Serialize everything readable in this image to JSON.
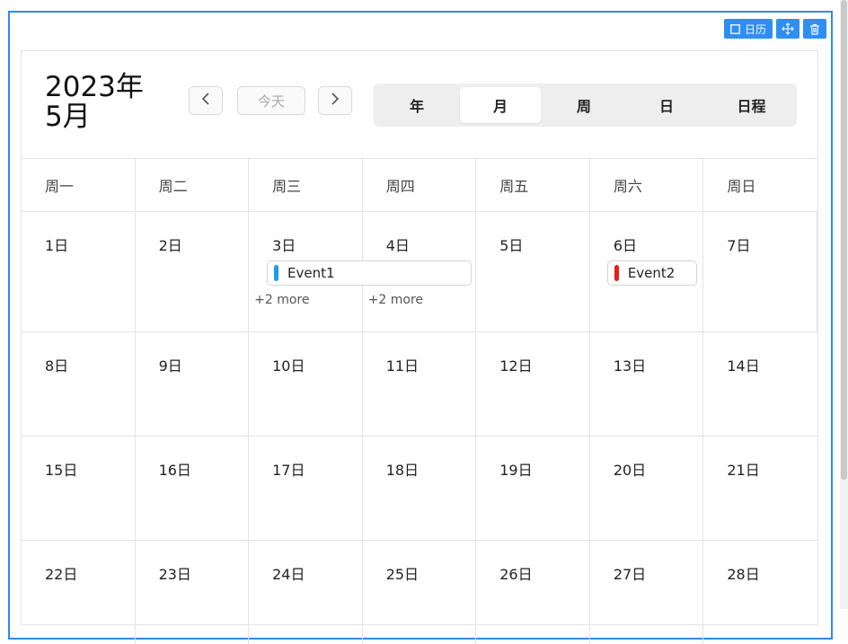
{
  "toolbar": {
    "calendar_label": "日历",
    "calendar_icon": "calendar-square-icon",
    "move_icon": "move-arrows-icon",
    "delete_icon": "trash-icon"
  },
  "header": {
    "title_line1": "2023年",
    "title_line2": "5月",
    "prev": "‹",
    "today": "今天",
    "next": "›"
  },
  "views": [
    {
      "label": "年",
      "active": false
    },
    {
      "label": "月",
      "active": true
    },
    {
      "label": "周",
      "active": false
    },
    {
      "label": "日",
      "active": false
    },
    {
      "label": "日程",
      "active": false
    }
  ],
  "weekdays": [
    "周一",
    "周二",
    "周三",
    "周四",
    "周五",
    "周六",
    "周日"
  ],
  "weeks": [
    [
      "1日",
      "2日",
      "3日",
      "4日",
      "5日",
      "6日",
      "7日"
    ],
    [
      "8日",
      "9日",
      "10日",
      "11日",
      "12日",
      "13日",
      "14日"
    ],
    [
      "15日",
      "16日",
      "17日",
      "18日",
      "19日",
      "20日",
      "21日"
    ],
    [
      "22日",
      "23日",
      "24日",
      "25日",
      "26日",
      "27日",
      "28日"
    ]
  ],
  "events": [
    {
      "title": "Event1",
      "color": "#1e9ce8"
    },
    {
      "title": "Event2",
      "color": "#e81e1e"
    }
  ],
  "more_links": [
    "+2 more",
    "+2 more"
  ],
  "colors": {
    "accent": "#2a8cf0"
  }
}
